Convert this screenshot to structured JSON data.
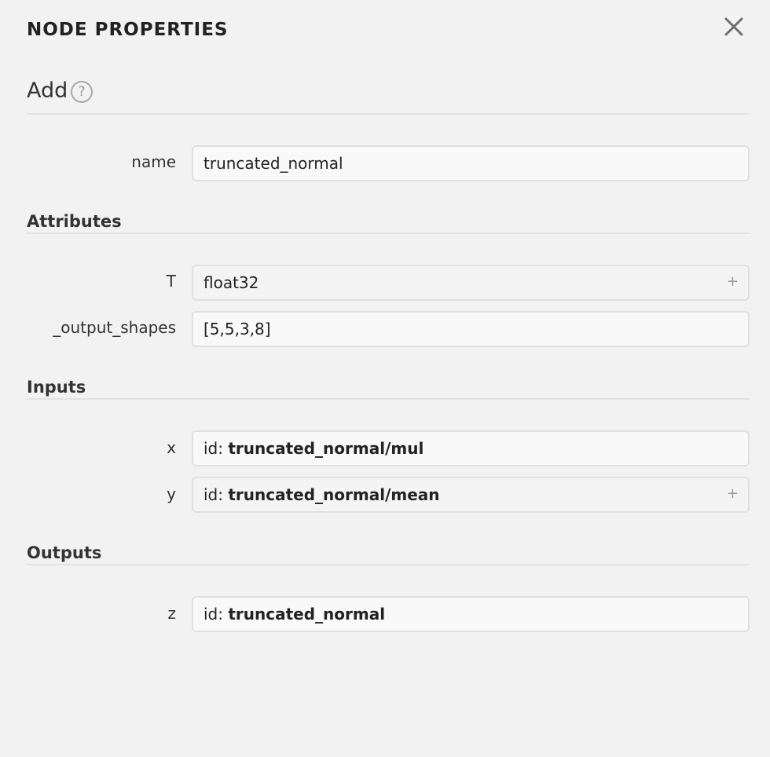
{
  "panel": {
    "title": "NODE PROPERTIES",
    "close_icon": "close-icon"
  },
  "node": {
    "op": "Add",
    "help_label": "?"
  },
  "name_row": {
    "label": "name",
    "value": "truncated_normal"
  },
  "attributes": {
    "header": "Attributes",
    "items": [
      {
        "label": "T",
        "value": "float32",
        "expand": "+"
      },
      {
        "label": "_output_shapes",
        "value": "[5,5,3,8]"
      }
    ]
  },
  "inputs": {
    "header": "Inputs",
    "items": [
      {
        "label": "x",
        "prefix": "id: ",
        "value": "truncated_normal/mul"
      },
      {
        "label": "y",
        "prefix": "id: ",
        "value": "truncated_normal/mean",
        "expand": "+"
      }
    ]
  },
  "outputs": {
    "header": "Outputs",
    "items": [
      {
        "label": "z",
        "prefix": "id: ",
        "value": "truncated_normal"
      }
    ]
  }
}
